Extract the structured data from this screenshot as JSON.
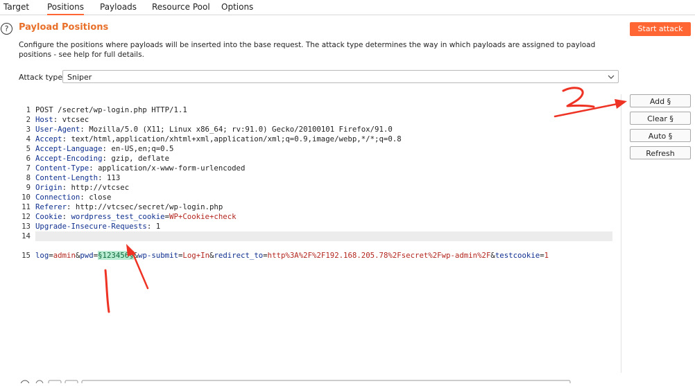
{
  "tabs": [
    {
      "label": "Target"
    },
    {
      "label": "Positions",
      "active": true
    },
    {
      "label": "Payloads"
    },
    {
      "label": "Resource Pool"
    },
    {
      "label": "Options"
    }
  ],
  "header": {
    "help_symbol": "?",
    "title": "Payload Positions",
    "description": "Configure the positions where payloads will be inserted into the base request. The attack type determines the way in which payloads are assigned to payload positions - see help for full details.",
    "start_attack_label": "Start attack"
  },
  "attack_type": {
    "label": "Attack type:",
    "value": "Sniper"
  },
  "side_buttons": {
    "add": "Add §",
    "clear": "Clear §",
    "auto": "Auto §",
    "refresh": "Refresh"
  },
  "request": {
    "line_numbers": [
      "1",
      "2",
      "3",
      "4",
      "5",
      "6",
      "7",
      "8",
      "9",
      "10",
      "11",
      "12",
      "13",
      "14",
      "15"
    ],
    "request_line": "POST /secret/wp-login.php HTTP/1.1",
    "headers": [
      {
        "name": "Host",
        "value": " vtcsec"
      },
      {
        "name": "User-Agent",
        "value": " Mozilla/5.0 (X11; Linux x86_64; rv:91.0) Gecko/20100101 Firefox/91.0"
      },
      {
        "name": "Accept",
        "value": " text/html,application/xhtml+xml,application/xml;q=0.9,image/webp,*/*;q=0.8"
      },
      {
        "name": "Accept-Language",
        "value": " en-US,en;q=0.5"
      },
      {
        "name": "Accept-Encoding",
        "value": " gzip, deflate"
      },
      {
        "name": "Content-Type",
        "value": " application/x-www-form-urlencoded"
      },
      {
        "name": "Content-Length",
        "value": " 113"
      },
      {
        "name": "Origin",
        "value": " http://vtcsec"
      },
      {
        "name": "Connection",
        "value": " close"
      },
      {
        "name": "Referer",
        "value": " http://vtcsec/secret/wp-login.php"
      }
    ],
    "cookie": {
      "name": "Cookie",
      "sep": ": ",
      "key": "wordpress_test_cookie",
      "eq": "=",
      "value": "WP+Cookie+check"
    },
    "upgrade": {
      "name": "Upgrade-Insecure-Requests",
      "value": " 1"
    },
    "body": {
      "k1": "log",
      "eq1": "=",
      "v1": "admin",
      "amp1": "&",
      "k2": "pwd",
      "eq2": "=",
      "payload": "§123456§",
      "amp2": "&",
      "k3": "wp-submit",
      "eq3": "=",
      "v3": "Log+In",
      "amp3": "&",
      "k4": "redirect_to",
      "eq4": "=",
      "v4": "http%3A%2F%2F192.168.205.78%2Fsecret%2Fwp-admin%2F",
      "amp4": "&",
      "k5": "testcookie",
      "eq5": "=",
      "v5": "1"
    }
  },
  "colors": {
    "accent": "#ff6633",
    "title": "#e8702a",
    "header_name": "#0f2f8f",
    "param_value": "#b3261e",
    "payload_highlight": "#b9ecd2",
    "annotation": "#ee3324"
  }
}
